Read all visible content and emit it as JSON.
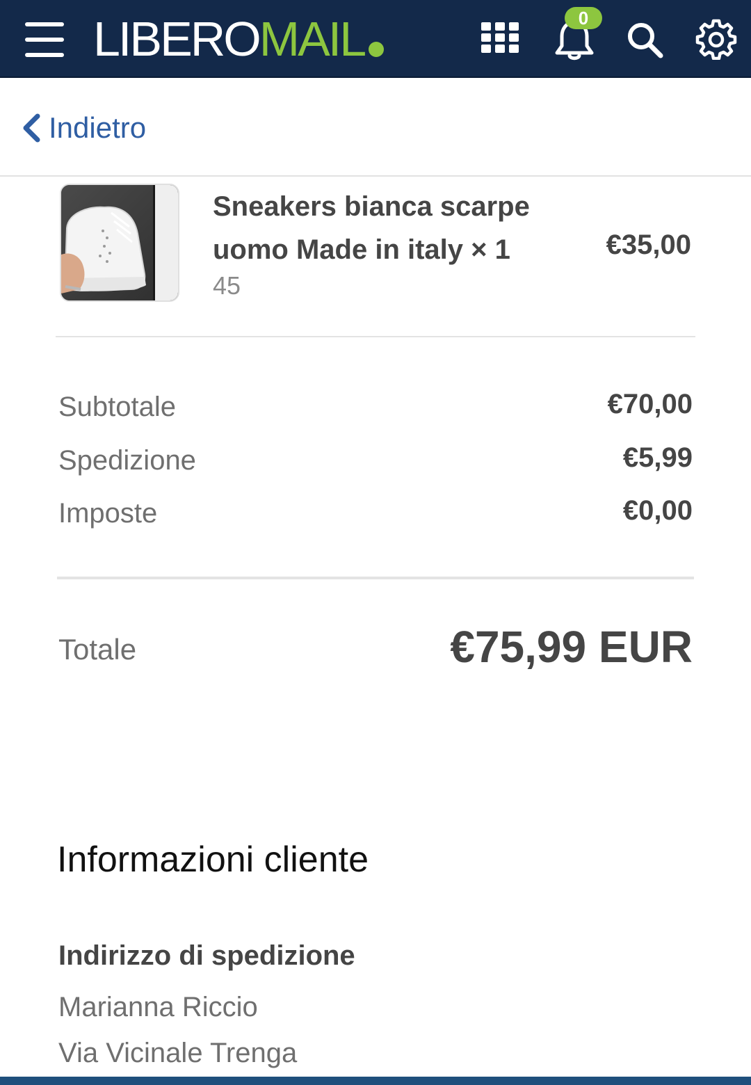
{
  "header": {
    "logo_part1": "LIBERO",
    "logo_part2": "MAIL",
    "notification_count": "0",
    "icons": [
      "hamburger-menu-icon",
      "apps-grid-icon",
      "bell-icon",
      "search-icon",
      "gear-icon"
    ],
    "colors": {
      "bar": "#13294a",
      "accent": "#8dc63f"
    }
  },
  "nav": {
    "back_label": "Indietro"
  },
  "product": {
    "name": "Sneakers bianca scarpe uomo Made in italy × 1",
    "variant": "45",
    "price": "€35,00"
  },
  "summary": {
    "rows": [
      {
        "label": "Subtotale",
        "value": "€70,00"
      },
      {
        "label": "Spedizione",
        "value": "€5,99"
      },
      {
        "label": "Imposte",
        "value": "€0,00"
      }
    ],
    "total_label": "Totale",
    "total_value": "€75,99 EUR"
  },
  "customer": {
    "section_title": "Informazioni cliente",
    "shipping_heading": "Indirizzo di spedizione",
    "address_lines": [
      "Marianna Riccio",
      "Via Vicinale Trenga"
    ]
  }
}
